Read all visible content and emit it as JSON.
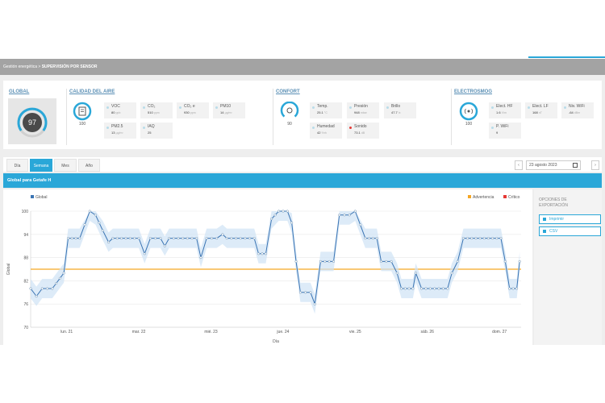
{
  "breadcrumb": {
    "root": "Gestión energética",
    "sep": ">",
    "current": "SUPERVISIÓN POR SENSOR"
  },
  "summary": {
    "global": {
      "title": "GLOBAL",
      "score": "97"
    },
    "air": {
      "title": "CALIDAD DEL AIRE",
      "score": "100",
      "tiles": [
        {
          "label": "VOC",
          "value": "80",
          "unit": "ppb"
        },
        {
          "label": "CO₂",
          "value": "510",
          "unit": "ppm"
        },
        {
          "label": "CO₂ e",
          "value": "930",
          "unit": "ppm"
        },
        {
          "label": "PM10",
          "value": "14",
          "unit": "µg/m³"
        },
        {
          "label": "PM2.5",
          "value": "13",
          "unit": "µg/m³"
        },
        {
          "label": "IAQ",
          "value": "25",
          "unit": ""
        }
      ]
    },
    "comfort": {
      "title": "CONFORT",
      "score": "90",
      "tiles": [
        {
          "label": "Temp.",
          "value": "25.1",
          "unit": "°C",
          "dot": "blue"
        },
        {
          "label": "Presión",
          "value": "948",
          "unit": "mbar",
          "dot": "blue"
        },
        {
          "label": "Brillo",
          "value": "47.7",
          "unit": "lx",
          "dot": "blue"
        },
        {
          "label": "Humedad",
          "value": "42",
          "unit": "%rh",
          "dot": "blue"
        },
        {
          "label": "Sonido",
          "value": "73.1",
          "unit": "dB",
          "dot": "red"
        }
      ]
    },
    "electrosmog": {
      "title": "ELECTROSMOG",
      "score": "100",
      "tiles": [
        {
          "label": "Elect. HF",
          "value": "1.6",
          "unit": "V/m"
        },
        {
          "label": "Elect. LF",
          "value": "168",
          "unit": "nT"
        },
        {
          "label": "Niv. WiFi",
          "value": "-64",
          "unit": "dBm"
        },
        {
          "label": "P. WiFi",
          "value": "9",
          "unit": ""
        }
      ]
    }
  },
  "tabs": [
    "Día",
    "Semana",
    "Mes",
    "Año"
  ],
  "active_tab": "Semana",
  "date": {
    "prev": "‹",
    "value": "23 agosto 2023",
    "next": "›"
  },
  "chart_header": "Global para Getafe H",
  "export": {
    "title": "OPCIONES DE EXPORTACIÓN",
    "print_label": "Imprimir",
    "csv_label": "CSV"
  },
  "colors": {
    "accent": "#2aa7d8",
    "series": "#3a74b3",
    "warning": "#f5a623",
    "critical": "#e53935"
  },
  "chart_data": {
    "type": "line",
    "legend": [
      {
        "name": "Global",
        "color": "#3a74b3"
      },
      {
        "name": "Advertencia",
        "color": "#f5a623"
      },
      {
        "name": "Crítico",
        "color": "#e53935"
      }
    ],
    "xlabel": "Día",
    "ylabel": "Global",
    "ylim": [
      70,
      100
    ],
    "yticks": [
      70,
      76,
      82,
      88,
      94,
      100
    ],
    "xticks": [
      "lun. 21",
      "mar. 22",
      "mié. 23",
      "jue. 24",
      "vie. 25",
      "sáb. 26",
      "dom. 27"
    ],
    "warning_level": 85,
    "series": [
      {
        "name": "Global",
        "values": [
          [
            0,
            80
          ],
          [
            0.8,
            78
          ],
          [
            1.6,
            80
          ],
          [
            3,
            80
          ],
          [
            4.6,
            84
          ],
          [
            5.2,
            93
          ],
          [
            6.8,
            93
          ],
          [
            8.2,
            100
          ],
          [
            9,
            99
          ],
          [
            10,
            95
          ],
          [
            10.8,
            92
          ],
          [
            11.4,
            93
          ],
          [
            15,
            93
          ],
          [
            15.8,
            89
          ],
          [
            16.6,
            93
          ],
          [
            18,
            93
          ],
          [
            18.6,
            91
          ],
          [
            19.2,
            93
          ],
          [
            23,
            93
          ],
          [
            23.6,
            88
          ],
          [
            24.4,
            93
          ],
          [
            25.8,
            93
          ],
          [
            26.6,
            94
          ],
          [
            27.2,
            93
          ],
          [
            31,
            93
          ],
          [
            31.6,
            89
          ],
          [
            32.6,
            89
          ],
          [
            33.4,
            98
          ],
          [
            34.4,
            100
          ],
          [
            35.6,
            100
          ],
          [
            36.2,
            97
          ],
          [
            36.8,
            87
          ],
          [
            37.4,
            79
          ],
          [
            38.8,
            79
          ],
          [
            39.4,
            76
          ],
          [
            40.2,
            87
          ],
          [
            42,
            87
          ],
          [
            42.8,
            99
          ],
          [
            44.2,
            99
          ],
          [
            45,
            100
          ],
          [
            46.4,
            93
          ],
          [
            48,
            93
          ],
          [
            48.6,
            87
          ],
          [
            50,
            87
          ],
          [
            50.8,
            84
          ],
          [
            51.4,
            80
          ],
          [
            53,
            80
          ],
          [
            53.4,
            84
          ],
          [
            54.2,
            80
          ],
          [
            57.8,
            80
          ],
          [
            58.4,
            84
          ],
          [
            59.2,
            87
          ],
          [
            60,
            93
          ],
          [
            65.2,
            93
          ],
          [
            65.8,
            87
          ],
          [
            66.4,
            80
          ],
          [
            67.4,
            80
          ],
          [
            67.8,
            87
          ]
        ]
      }
    ]
  }
}
